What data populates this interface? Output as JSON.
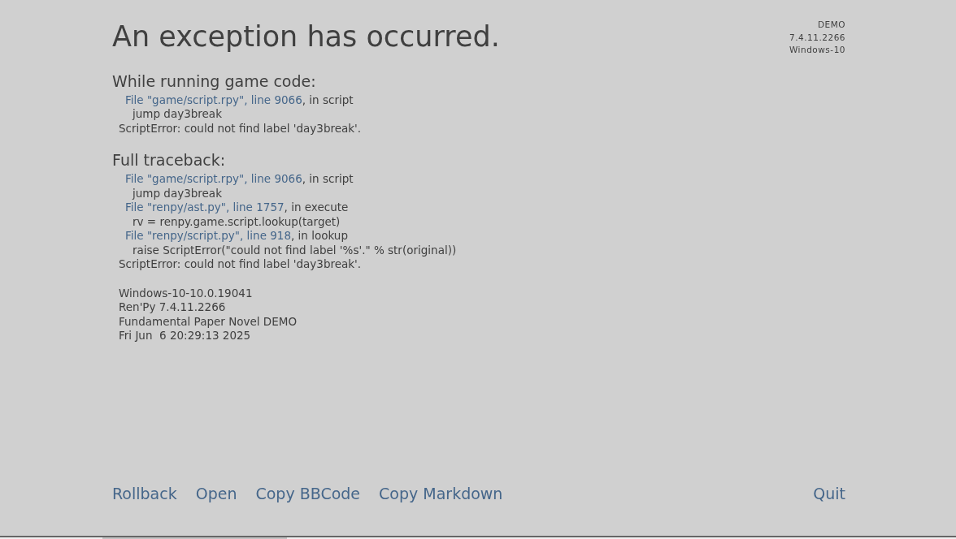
{
  "title": "An exception has occurred.",
  "version_info": [
    "DEMO",
    "7.4.11.2266",
    "Windows-10"
  ],
  "sections": [
    {
      "heading": "While running game code:",
      "lines": [
        {
          "kind": "frame",
          "link": "File \"game/script.rpy\", line 9066",
          "suffix": ", in script"
        },
        {
          "kind": "code",
          "text": "jump day3break"
        },
        {
          "kind": "error",
          "text": "ScriptError: could not find label 'day3break'."
        }
      ]
    },
    {
      "heading": "Full traceback:",
      "lines": [
        {
          "kind": "frame",
          "link": "File \"game/script.rpy\", line 9066",
          "suffix": ", in script"
        },
        {
          "kind": "code",
          "text": "jump day3break"
        },
        {
          "kind": "frame",
          "link": "File \"renpy/ast.py\", line 1757",
          "suffix": ", in execute"
        },
        {
          "kind": "code",
          "text": "rv = renpy.game.script.lookup(target)"
        },
        {
          "kind": "frame",
          "link": "File \"renpy/script.py\", line 918",
          "suffix": ", in lookup"
        },
        {
          "kind": "code",
          "text": "raise ScriptError(\"could not find label '%s'.\" % str(original))"
        },
        {
          "kind": "error",
          "text": "ScriptError: could not find label 'day3break'."
        }
      ]
    }
  ],
  "system_info": [
    "Windows-10-10.0.19041",
    "Ren'Py 7.4.11.2266",
    "Fundamental Paper Novel DEMO",
    "Fri Jun  6 20:29:13 2025"
  ],
  "actions": [
    "Rollback",
    "Open",
    "Copy BBCode",
    "Copy Markdown"
  ],
  "quit": "Quit"
}
